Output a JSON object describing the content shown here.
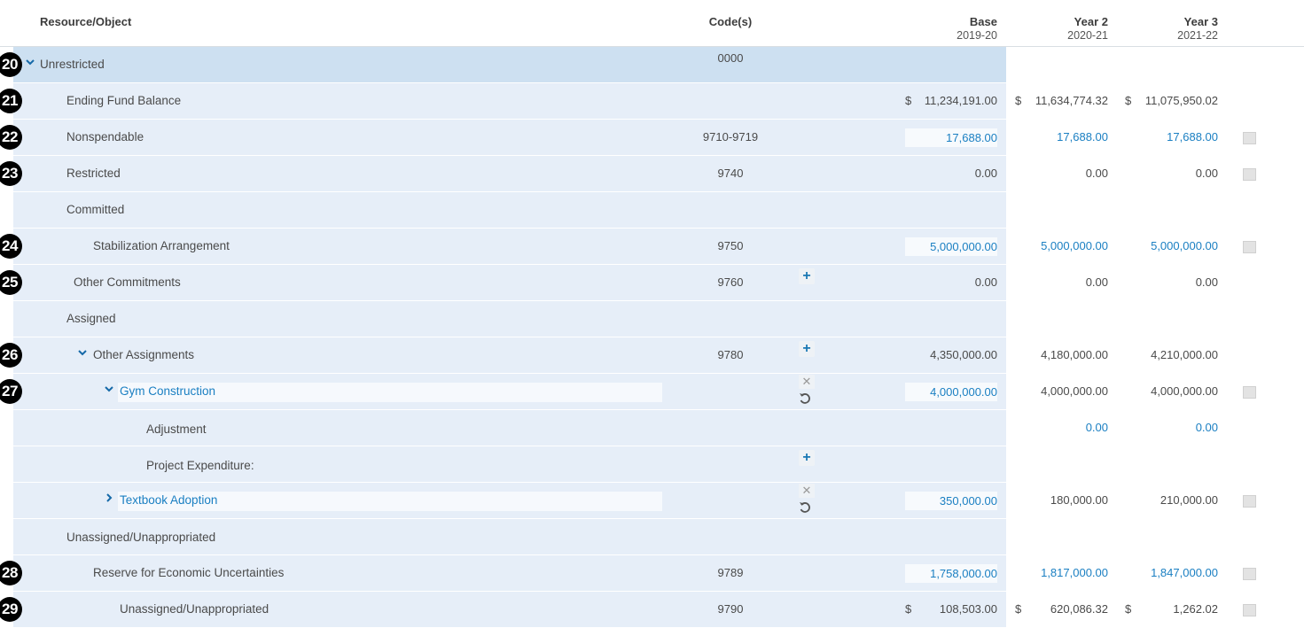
{
  "header": {
    "resource_object": "Resource/Object",
    "codes": "Code(s)",
    "base": "Base",
    "base_year": "2019-20",
    "year2": "Year 2",
    "year2_year": "2020-21",
    "year3": "Year 3",
    "year3_year": "2021-22"
  },
  "rows": [
    {
      "badge": "20",
      "label": "Unrestricted",
      "code": "0000",
      "base": "",
      "y2": "",
      "y3": ""
    },
    {
      "badge": "21",
      "label": "Ending Fund Balance",
      "code": "",
      "base_dollar": "$",
      "base": "11,234,191.00",
      "y2_dollar": "$",
      "y2": "11,634,774.32",
      "y3_dollar": "$",
      "y3": "11,075,950.02"
    },
    {
      "badge": "22",
      "label": "Nonspendable",
      "code": "9710-9719",
      "base": "17,688.00",
      "y2": "17,688.00",
      "y3": "17,688.00"
    },
    {
      "badge": "23",
      "label": "Restricted",
      "code": "9740",
      "base": "0.00",
      "y2": "0.00",
      "y3": "0.00"
    },
    {
      "badge": "",
      "label": "Committed",
      "code": "",
      "base": "",
      "y2": "",
      "y3": ""
    },
    {
      "badge": "24",
      "label": "Stabilization Arrangement",
      "code": "9750",
      "base": "5,000,000.00",
      "y2": "5,000,000.00",
      "y3": "5,000,000.00"
    },
    {
      "badge": "25",
      "label": "Other Commitments",
      "code": "9760",
      "base": "0.00",
      "y2": "0.00",
      "y3": "0.00"
    },
    {
      "badge": "",
      "label": "Assigned",
      "code": "",
      "base": "",
      "y2": "",
      "y3": ""
    },
    {
      "badge": "26",
      "label": "Other Assignments",
      "code": "9780",
      "base": "4,350,000.00",
      "y2": "4,180,000.00",
      "y3": "4,210,000.00"
    },
    {
      "badge": "27",
      "label": "Gym Construction",
      "code": "",
      "base": "4,000,000.00",
      "y2": "4,000,000.00",
      "y3": "4,000,000.00"
    },
    {
      "badge": "",
      "label": "Adjustment",
      "code": "",
      "base": "",
      "y2": "0.00",
      "y3": "0.00"
    },
    {
      "badge": "",
      "label": "Project Expenditure:",
      "code": "",
      "base": "",
      "y2": "",
      "y3": ""
    },
    {
      "badge": "",
      "label": "Textbook Adoption",
      "code": "",
      "base": "350,000.00",
      "y2": "180,000.00",
      "y3": "210,000.00"
    },
    {
      "badge": "",
      "label": "Unassigned/Unappropriated",
      "code": "",
      "base": "",
      "y2": "",
      "y3": ""
    },
    {
      "badge": "28",
      "label": "Reserve for Economic Uncertainties",
      "code": "9789",
      "base": "1,758,000.00",
      "y2": "1,817,000.00",
      "y3": "1,847,000.00"
    },
    {
      "badge": "29",
      "label": "Unassigned/Unappropriated",
      "code": "9790",
      "base_dollar": "$",
      "base": "108,503.00",
      "y2_dollar": "$",
      "y2": "620,086.32",
      "y3_dollar": "$",
      "y3": "1,262.02"
    }
  ],
  "icons": {
    "expand": "chevron-down-icon",
    "collapsed": "chevron-right-icon",
    "add": "plus-icon",
    "remove": "close-icon",
    "revert": "undo-icon",
    "note": "note-icon"
  },
  "colors": {
    "row_bg": "#e6eef8",
    "selected_row_bg": "#cde0f1",
    "link": "#1a7fc2",
    "badge": "#000000"
  }
}
